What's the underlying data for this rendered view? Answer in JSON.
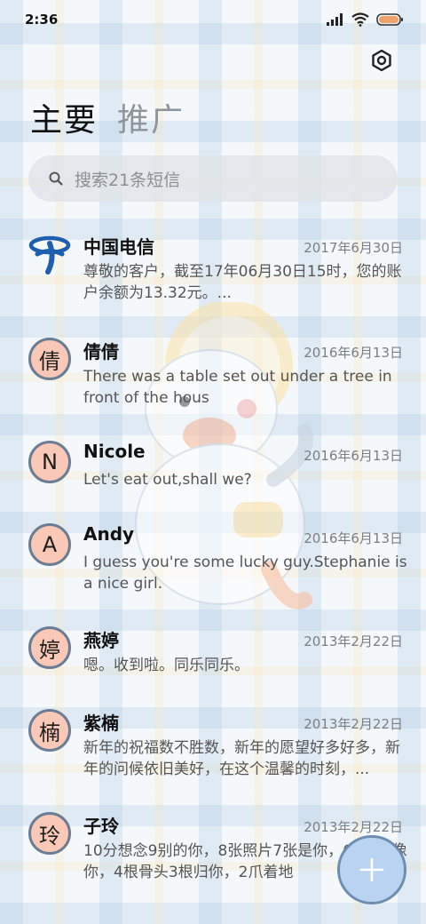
{
  "status_bar": {
    "time": "2:36"
  },
  "tabs": [
    {
      "label": "主要"
    },
    {
      "label": "推广"
    }
  ],
  "search": {
    "placeholder": "搜索21条短信"
  },
  "colors": {
    "avatar_bg": "#f9c8b6",
    "avatar_border": "#6a7d94",
    "fab_bg": "#b9d3f0",
    "logo_blue": "#1f5fb0"
  },
  "messages": [
    {
      "name": "中国电信",
      "avatar": "",
      "avatar_icon": "china-telecom-logo",
      "date": "2017年6月30日",
      "preview": "尊敬的客户，截至17年06月30日15时，您的账户余额为13.32元。..."
    },
    {
      "name": "倩倩",
      "avatar": "倩",
      "date": "2016年6月13日",
      "preview": "There was a table set out under a tree in front of the hous"
    },
    {
      "name": "Nicole",
      "avatar": "N",
      "date": "2016年6月13日",
      "preview": "Let's eat out,shall we?"
    },
    {
      "name": "Andy",
      "avatar": "A",
      "date": "2016年6月13日",
      "preview": "I guess you're some lucky guy.Stephanie is a nice girl."
    },
    {
      "name": "燕婷",
      "avatar": "婷",
      "date": "2013年2月22日",
      "preview": "嗯。收到啦。同乐同乐。"
    },
    {
      "name": "紫楠",
      "avatar": "楠",
      "date": "2013年2月22日",
      "preview": "新年的祝福数不胜数，新年的愿望好多好多，新年的问候依旧美好，在这个温馨的时刻，..."
    },
    {
      "name": "子玲",
      "avatar": "玲",
      "date": "2013年2月22日",
      "preview": "10分想念9别的你，8张照片7张是你，6张5只像你，4根骨头3根归你，2爪着地"
    }
  ],
  "fab": {
    "icon": "plus-icon"
  }
}
